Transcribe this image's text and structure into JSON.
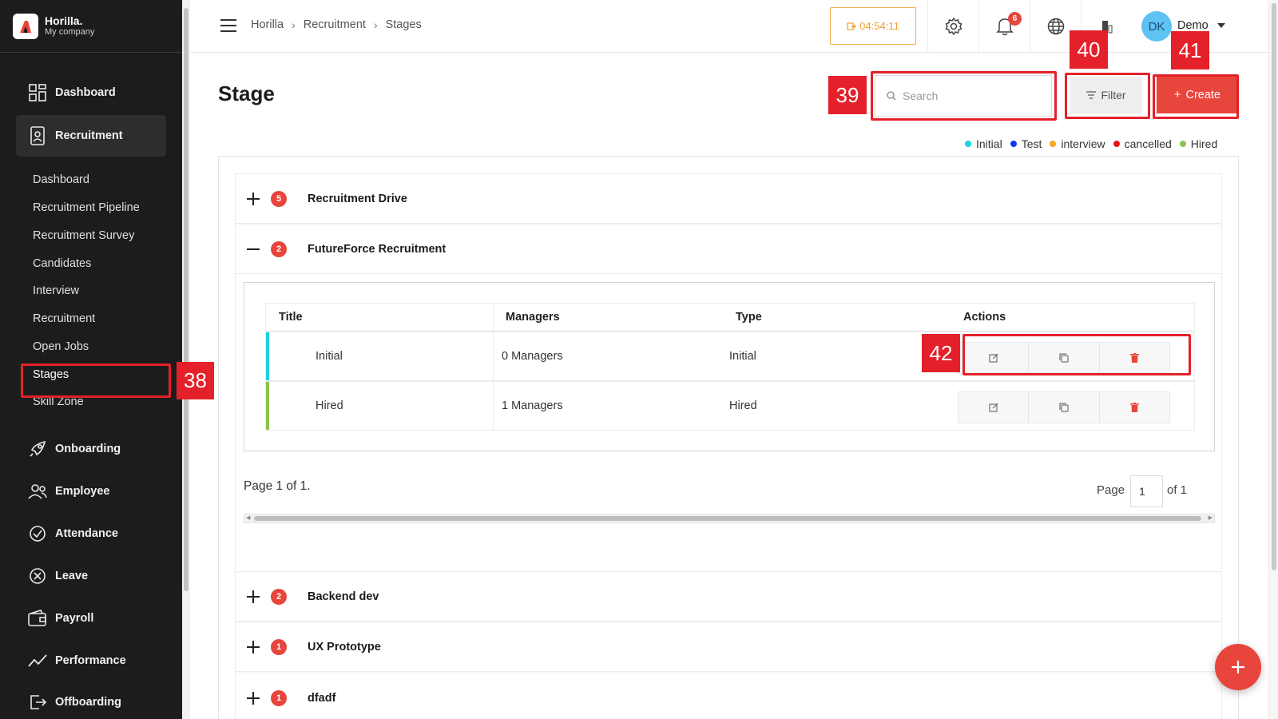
{
  "brand": {
    "name": "Horilla.",
    "company": "My company"
  },
  "sidebar": {
    "items": [
      {
        "label": "Dashboard",
        "icon": "grid-icon"
      },
      {
        "label": "Recruitment",
        "icon": "recruitment-icon"
      },
      {
        "label": "Onboarding",
        "icon": "rocket-icon"
      },
      {
        "label": "Employee",
        "icon": "people-icon"
      },
      {
        "label": "Attendance",
        "icon": "check-circle-icon"
      },
      {
        "label": "Leave",
        "icon": "x-circle-icon"
      },
      {
        "label": "Payroll",
        "icon": "wallet-icon"
      },
      {
        "label": "Performance",
        "icon": "trend-icon"
      },
      {
        "label": "Offboarding",
        "icon": "exit-icon"
      }
    ],
    "sub_items": [
      {
        "label": "Dashboard"
      },
      {
        "label": "Recruitment Pipeline"
      },
      {
        "label": "Recruitment Survey"
      },
      {
        "label": "Candidates"
      },
      {
        "label": "Interview"
      },
      {
        "label": "Recruitment"
      },
      {
        "label": "Open Jobs"
      },
      {
        "label": "Stages"
      },
      {
        "label": "Skill Zone"
      }
    ]
  },
  "topbar": {
    "breadcrumb": [
      "Horilla",
      "Recruitment",
      "Stages"
    ],
    "timer": "04:54:11",
    "notification_count": "6",
    "avatar_initials": "DK",
    "user_name": "Demo"
  },
  "page": {
    "title": "Stage",
    "search_placeholder": "Search",
    "filter_label": "Filter",
    "create_label": "Create",
    "legend": [
      {
        "label": "Initial",
        "color": "#18d3e4"
      },
      {
        "label": "Test",
        "color": "#0a3cf0"
      },
      {
        "label": "interview",
        "color": "#f5a623"
      },
      {
        "label": "cancelled",
        "color": "#e81414"
      },
      {
        "label": "Hired",
        "color": "#8bc34a"
      }
    ]
  },
  "groups": [
    {
      "name": "Recruitment Drive",
      "count": "5",
      "expanded": false
    },
    {
      "name": "FutureForce Recruitment",
      "count": "2",
      "expanded": true
    },
    {
      "name": "Backend dev",
      "count": "2",
      "expanded": false
    },
    {
      "name": "UX Prototype",
      "count": "1",
      "expanded": false
    },
    {
      "name": "dfadf",
      "count": "1",
      "expanded": false
    }
  ],
  "stage_table": {
    "headers": {
      "title": "Title",
      "managers": "Managers",
      "type": "Type",
      "actions": "Actions"
    },
    "rows": [
      {
        "title": "Initial",
        "managers": "0 Managers",
        "type": "Initial",
        "accent": "#18d3e4"
      },
      {
        "title": "Hired",
        "managers": "1 Managers",
        "type": "Hired",
        "accent": "#8bc34a"
      }
    ]
  },
  "pagination": {
    "summary": "Page 1 of 1.",
    "page_label": "Page",
    "page_value": "1",
    "of_label": "of 1"
  },
  "annotations": [
    "38",
    "39",
    "40",
    "41",
    "42"
  ]
}
